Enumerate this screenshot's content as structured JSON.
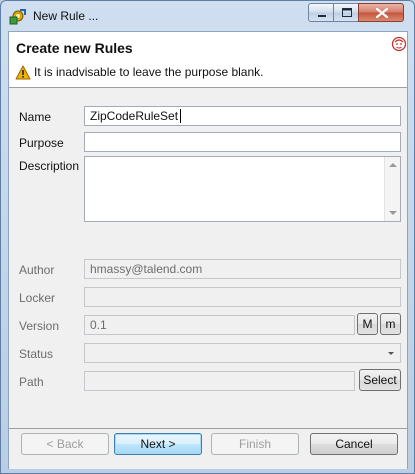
{
  "window": {
    "title": "New Rule ..."
  },
  "header": {
    "title": "Create new Rules",
    "message": "It is inadvisable to leave the purpose blank."
  },
  "form": {
    "name": {
      "label": "Name",
      "value": "ZipCodeRuleSet"
    },
    "purpose": {
      "label": "Purpose",
      "value": ""
    },
    "description": {
      "label": "Description",
      "value": ""
    },
    "author": {
      "label": "Author",
      "value": "hmassy@talend.com"
    },
    "locker": {
      "label": "Locker",
      "value": ""
    },
    "version": {
      "label": "Version",
      "value": "0.1",
      "major_label": "M",
      "minor_label": "m"
    },
    "status": {
      "label": "Status",
      "value": ""
    },
    "path": {
      "label": "Path",
      "value": "",
      "select_label": "Select"
    }
  },
  "buttons": {
    "back": "< Back",
    "next": "Next >",
    "finish": "Finish",
    "cancel": "Cancel"
  },
  "icons": {
    "app": "puzzle-gear-icon",
    "warning": "warning-icon",
    "logo": "talend-logo-icon"
  },
  "colors": {
    "title_bar": "#cfdff0",
    "close_button": "#c4543c",
    "default_button": "#3c7fb1",
    "warning": "#f0b400"
  }
}
